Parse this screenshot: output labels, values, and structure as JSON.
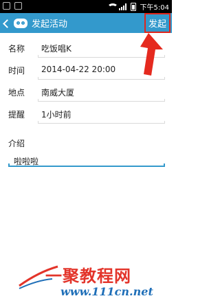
{
  "statusbar": {
    "time": "下午5:04"
  },
  "appbar": {
    "title": "发起活动",
    "action_label": "发起"
  },
  "form": {
    "fields": [
      {
        "label": "名称",
        "value": "吃饭唱K"
      },
      {
        "label": "时间",
        "value": "2014-04-22 20:00"
      },
      {
        "label": "地点",
        "value": "南威大厦"
      },
      {
        "label": "提醒",
        "value": "1小时前"
      }
    ],
    "intro_label": "介绍",
    "intro_value": "啦啦啦"
  },
  "watermark": {
    "text": "一聚教程网",
    "url": "www.111cn.net"
  },
  "colors": {
    "appbar": "#3399cc",
    "highlight": "#e0251b"
  }
}
